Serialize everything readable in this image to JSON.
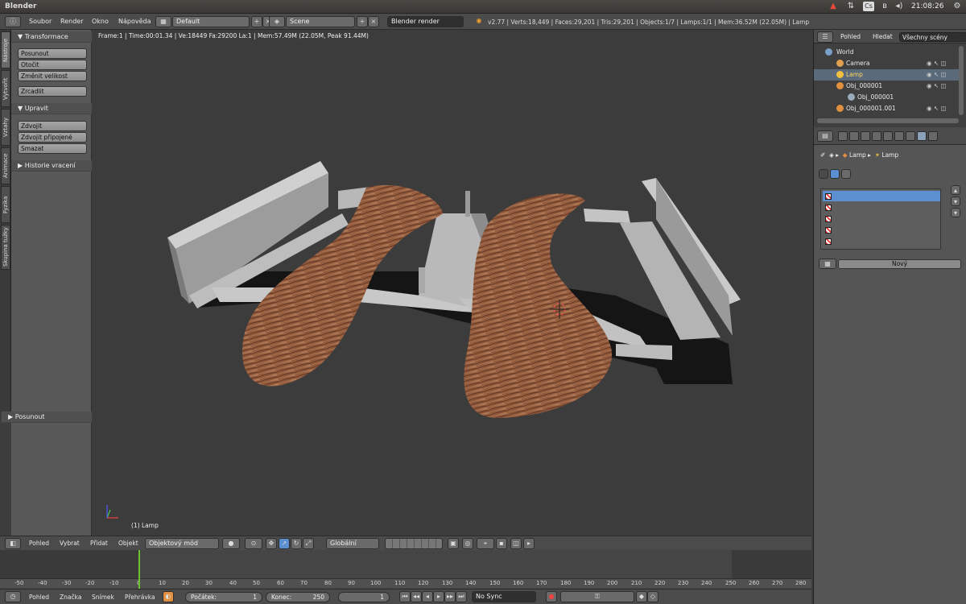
{
  "app": {
    "title": "Blender"
  },
  "system": {
    "clock": "21:08:26"
  },
  "menu": {
    "items": [
      "Soubor",
      "Render",
      "Okno",
      "Nápověda"
    ],
    "layout": "Default",
    "scene": "Scene",
    "engine": "Blender render",
    "stats": "v2.77 | Verts:18,449 | Faces:29,201 | Tris:29,201 | Objects:1/7 | Lamps:1/1 | Mem:36.52M (22.05M) | Lamp"
  },
  "left_tabs": [
    "Nástroje",
    "Vytvořit",
    "Vztahy",
    "Animace",
    "Fyzika",
    "Skupina tužky"
  ],
  "toolshelf": {
    "transform_header": "Transformace",
    "transform_buttons": [
      "Posunout",
      "Otočit",
      "Změnit velikost"
    ],
    "mirror_button": "Zrcadlit",
    "edit_header": "Upravit",
    "edit_buttons": [
      "Zdvojit",
      "Zdvojit připojené",
      "Smazat"
    ],
    "history_header": "Historie vracení",
    "operator_header": "Posunout"
  },
  "viewport": {
    "info": "Frame:1 | Time:00:01.34 | Ve:18449 Fa:29200 La:1 | Mem:57.49M (22.05M, Peak 91.44M)",
    "object_label": "(1) Lamp"
  },
  "outliner": {
    "tabs": [
      "Pohled",
      "Hledat",
      "Všechny scény"
    ],
    "items": [
      "World",
      "Camera",
      "Lamp",
      "Obj_000001",
      "Obj_000001",
      "Obj_000001.001"
    ]
  },
  "properties": {
    "breadcrumb": [
      "Lamp",
      "Lamp"
    ],
    "new_button": "Nový"
  },
  "view3d_header": {
    "items": [
      "Pohled",
      "Vybrat",
      "Přidat",
      "Objekt"
    ],
    "mode": "Objektový mód",
    "orientation": "Globální"
  },
  "timeline": {
    "ticks": [
      "-50",
      "-40",
      "-30",
      "-20",
      "-10",
      "0",
      "10",
      "20",
      "30",
      "40",
      "50",
      "60",
      "70",
      "80",
      "90",
      "100",
      "110",
      "120",
      "130",
      "140",
      "150",
      "160",
      "170",
      "180",
      "190",
      "200",
      "210",
      "220",
      "230",
      "240",
      "250",
      "260",
      "270",
      "280"
    ],
    "current_frame": 1,
    "header_items": [
      "Pohled",
      "Značka",
      "Snímek",
      "Přehrávka"
    ],
    "start": "Počátek:",
    "start_value": "1",
    "end": "Konec:",
    "end_value": "250",
    "frame_value": "1",
    "sync": "No Sync"
  }
}
